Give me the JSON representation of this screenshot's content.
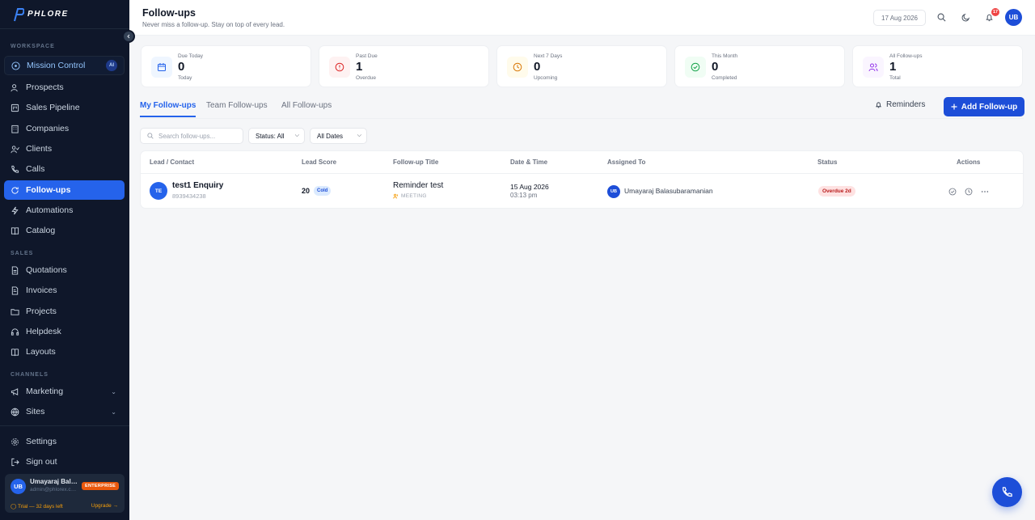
{
  "brand": {
    "logo_text": "PHLORE"
  },
  "sidebar": {
    "workspace_label": "WORKSPACE",
    "mission_control": {
      "label": "Mission Control",
      "badge": "AI"
    },
    "workspace_items": [
      {
        "label": "Prospects",
        "icon": "users-icon"
      },
      {
        "label": "Sales Pipeline",
        "icon": "pipeline-icon"
      },
      {
        "label": "Companies",
        "icon": "building-icon"
      },
      {
        "label": "Clients",
        "icon": "user-check-icon"
      },
      {
        "label": "Calls",
        "icon": "phone-icon"
      },
      {
        "label": "Follow-ups",
        "icon": "refresh-icon",
        "active": true
      },
      {
        "label": "Automations",
        "icon": "bolt-icon"
      },
      {
        "label": "Catalog",
        "icon": "book-icon"
      }
    ],
    "sales_label": "SALES",
    "sales_items": [
      {
        "label": "Quotations",
        "icon": "document-icon"
      },
      {
        "label": "Invoices",
        "icon": "invoice-icon"
      },
      {
        "label": "Projects",
        "icon": "folder-icon"
      },
      {
        "label": "Helpdesk",
        "icon": "headset-icon"
      },
      {
        "label": "Layouts",
        "icon": "layout-icon"
      }
    ],
    "channels_label": "CHANNELS",
    "channel_items": [
      {
        "label": "Marketing",
        "icon": "megaphone-icon"
      },
      {
        "label": "Sites",
        "icon": "globe-icon"
      }
    ],
    "settings_label": "Settings",
    "signout_label": "Sign out",
    "user": {
      "initials": "UB",
      "name": "Umayaraj Balasubaramanian",
      "email": "admin@phlorex.com",
      "plan": "ENTERPRISE",
      "trial": "Trial — 32 days left",
      "upgrade": "Upgrade →"
    }
  },
  "header": {
    "title": "Follow-ups",
    "subtitle": "Never miss a follow-up. Stay on top of every lead.",
    "date": "17 Aug 2026",
    "notifications": "17",
    "avatar_initials": "UB"
  },
  "stats": [
    {
      "label": "Due Today",
      "value": "0",
      "caption": "Today",
      "color": "#2563eb",
      "bg": "#eff6ff",
      "icon": "calendar-icon"
    },
    {
      "label": "Past Due",
      "value": "1",
      "caption": "Overdue",
      "color": "#dc2626",
      "bg": "#fef2f2",
      "icon": "alert-circle-icon"
    },
    {
      "label": "Next 7 Days",
      "value": "0",
      "caption": "Upcoming",
      "color": "#d97706",
      "bg": "#fffbeb",
      "icon": "clock-icon"
    },
    {
      "label": "This Month",
      "value": "0",
      "caption": "Completed",
      "color": "#16a34a",
      "bg": "#f0fdf4",
      "icon": "check-circle-icon"
    },
    {
      "label": "All Follow-ups",
      "value": "1",
      "caption": "Total",
      "color": "#9333ea",
      "bg": "#faf5ff",
      "icon": "users-icon"
    }
  ],
  "tabs": [
    {
      "label": "My Follow-ups",
      "active": true
    },
    {
      "label": "Team Follow-ups"
    },
    {
      "label": "All Follow-ups"
    }
  ],
  "actions": {
    "reminders": "Reminders",
    "add": "Add Follow-up"
  },
  "filters": {
    "search_placeholder": "Search follow-ups...",
    "status": "Status: All",
    "dates": "All Dates"
  },
  "table": {
    "headers": [
      "Lead / Contact",
      "Lead Score",
      "Follow-up Title",
      "Date & Time",
      "Assigned To",
      "Status",
      "Actions"
    ],
    "rows": [
      {
        "initials": "TE",
        "lead_name": "test1 Enquiry",
        "phone": "8939434238",
        "score": "20",
        "temperature": "Cold",
        "title": "Reminder test",
        "type": "MEETING",
        "date": "15 Aug 2026",
        "time": "03:13 pm",
        "assignee_initials": "UB",
        "assignee": "Umayaraj Balasubaramanian",
        "status": "Overdue 2d"
      }
    ]
  }
}
